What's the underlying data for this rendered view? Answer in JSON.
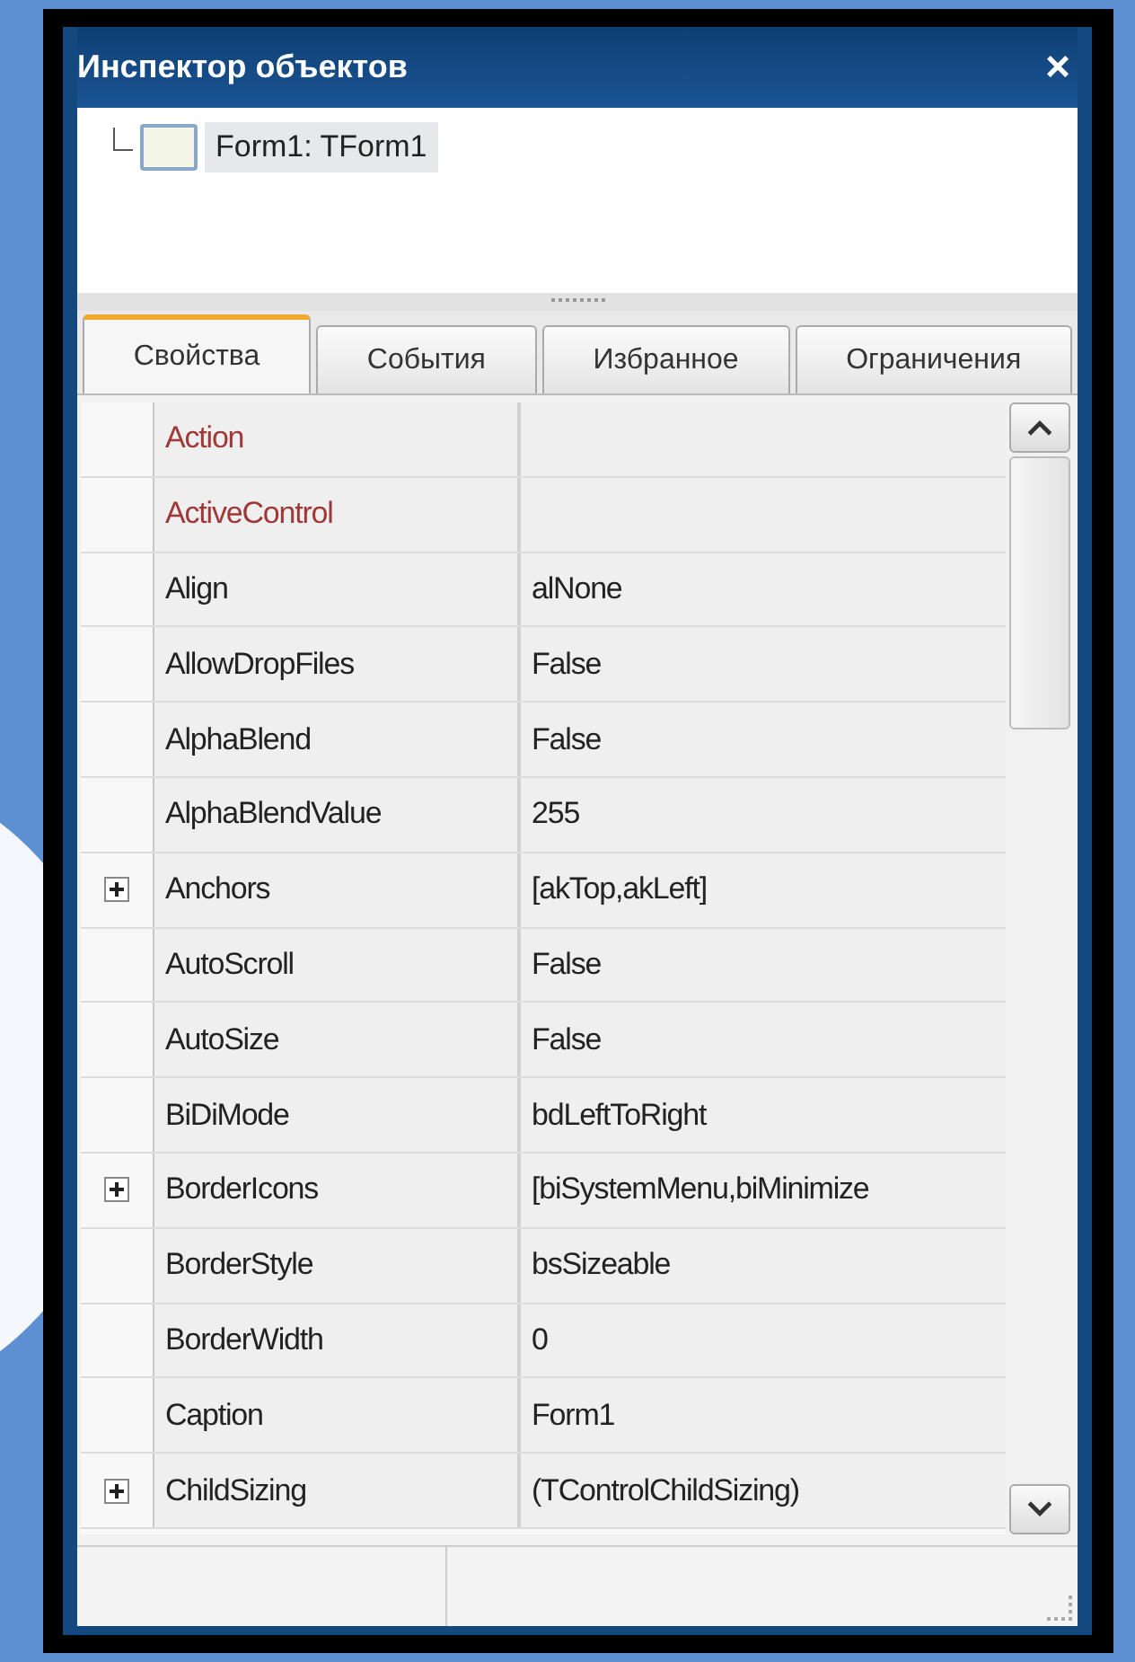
{
  "window": {
    "title": "Инспектор объектов",
    "close": "×"
  },
  "tree": [
    {
      "label": "Form1: TForm1",
      "selected": true
    }
  ],
  "tabs": [
    {
      "label": "Свойства",
      "selected": true
    },
    {
      "label": "События",
      "selected": false
    },
    {
      "label": "Избранное",
      "selected": false
    },
    {
      "label": "Ограничения",
      "selected": false
    }
  ],
  "properties": [
    {
      "name": "Action",
      "kind": "reference"
    },
    {
      "name": "ActiveControl",
      "kind": "reference"
    },
    {
      "name": "Align",
      "value": "alNone",
      "kind": "plain"
    },
    {
      "name": "AllowDropFiles",
      "value": "False",
      "kind": "plain"
    },
    {
      "name": "AlphaBlend",
      "value": "False",
      "kind": "plain"
    },
    {
      "name": "AlphaBlendValue",
      "value": "255",
      "kind": "plain"
    },
    {
      "name": "Anchors",
      "value": "[akTop,akLeft]",
      "kind": "group"
    },
    {
      "name": "AutoScroll",
      "value": "False",
      "kind": "plain"
    },
    {
      "name": "AutoSize",
      "value": "False",
      "kind": "plain"
    },
    {
      "name": "BiDiMode",
      "value": "bdLeftToRight",
      "kind": "plain"
    },
    {
      "name": "BorderIcons",
      "value": "[biSystemMenu,biMinimize",
      "kind": "group"
    },
    {
      "name": "BorderStyle",
      "value": "bsSizeable",
      "kind": "plain"
    },
    {
      "name": "BorderWidth",
      "value": "0",
      "kind": "plain"
    },
    {
      "name": "Caption",
      "value": "Form1",
      "kind": "plain"
    },
    {
      "name": "ChildSizing",
      "value": "(TControlChildSizing)",
      "kind": "group"
    }
  ]
}
